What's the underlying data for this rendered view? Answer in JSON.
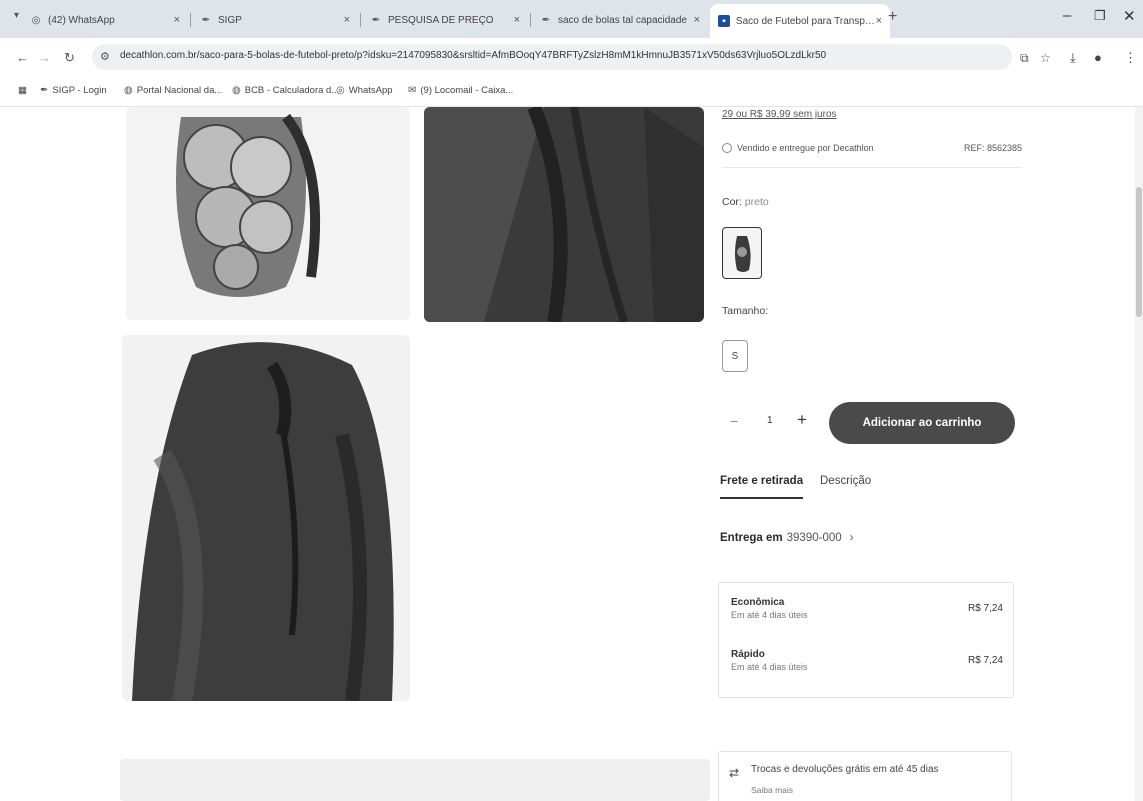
{
  "browser": {
    "tabs": [
      {
        "title": "(42) WhatsApp",
        "icon": "whatsapp-icon"
      },
      {
        "title": "SIGP",
        "icon": "pen-icon"
      },
      {
        "title": "PESQUISA DE PREÇO",
        "icon": "pen-icon"
      },
      {
        "title": "saco de bolas tal capacidade",
        "icon": "pen-icon"
      },
      {
        "title": "Saco de Futebol para Transport",
        "icon": "decathlon-icon",
        "active": true
      }
    ],
    "url": "decathlon.com.br/saco-para-5-bolas-de-futebol-preto/p?idsku=2147095830&srsltid=AfmBOoqY47BRFTyZslzH8mM1kHmnuJB3571xV50ds63Vrjluo5OLzdLkr50",
    "bookmarks": [
      {
        "label": "SIGP - Login"
      },
      {
        "label": "Portal Nacional da..."
      },
      {
        "label": "BCB - Calculadora d..."
      },
      {
        "label": "WhatsApp"
      },
      {
        "label": "(9) Locomail - Caixa..."
      }
    ]
  },
  "product": {
    "price_note": "29 ou R$ 39,99 sem juros",
    "seller": "Vendido e entregue por Decathlon",
    "ref": "REF: 8562385",
    "color_label": "Cor:",
    "color_value": "preto",
    "size_label": "Tamanho:",
    "size_option": "S",
    "quantity": "1",
    "add_to_cart": "Adicionar ao carrinho"
  },
  "tabs": {
    "shipping": "Frete e retirada",
    "description": "Descrição"
  },
  "delivery": {
    "label": "Entrega em",
    "cep": "39390-000",
    "options": [
      {
        "name": "Econômica",
        "eta": "Em até 4 dias úteis",
        "price": "R$ 7,24"
      },
      {
        "name": "Rápido",
        "eta": "Em até 4 dias úteis",
        "price": "R$ 7,24"
      }
    ]
  },
  "returns": {
    "title": "Trocas e devoluções grátis em até 45 dias",
    "link": "Saiba mais"
  },
  "colors": {
    "bag": "#3b3b3b",
    "button": "#4a4a4a"
  }
}
